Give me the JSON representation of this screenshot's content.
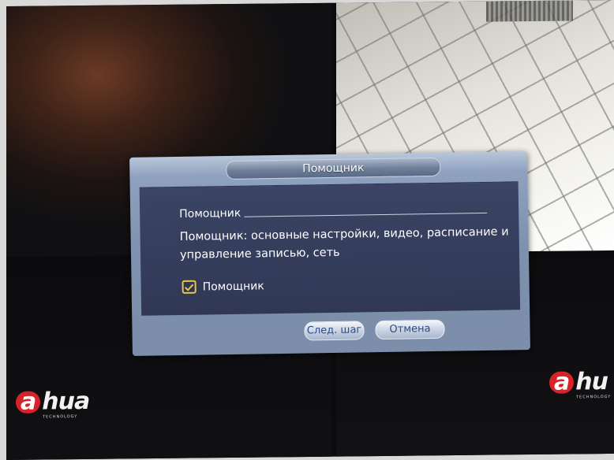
{
  "dialog": {
    "title": "Помощник",
    "section_label": "Помощник",
    "description": "Помощник: основные настройки, видео, расписание и управление записью, сеть",
    "checkbox": {
      "label": "Помощник",
      "checked": true
    },
    "buttons": {
      "next": "След. шаг",
      "cancel": "Отмена"
    }
  },
  "colors": {
    "dialog_frame": "#8ea1bf",
    "panel_bg": "#353e5c",
    "button_text": "#2d4a8a",
    "checkbox_accent": "#e8c64a",
    "logo_red": "#d8222a"
  },
  "logos": [
    {
      "text": "hua",
      "mark": "a",
      "subtitle": "TECHNOLOGY"
    },
    {
      "text": "hu",
      "mark": "a",
      "subtitle": "TECHNOLOGY"
    }
  ],
  "icons": {
    "checkbox": "check-icon"
  }
}
